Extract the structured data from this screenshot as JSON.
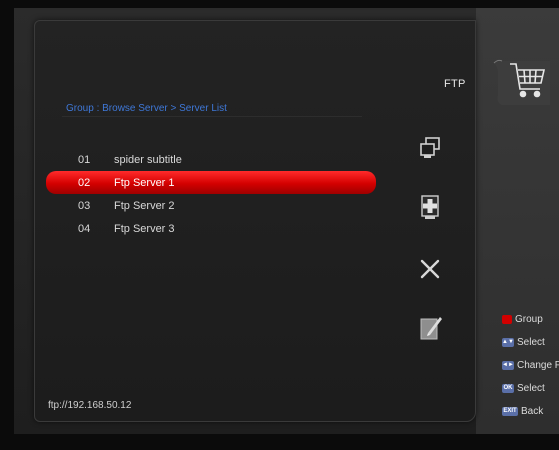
{
  "header": {
    "title": "FTP",
    "cart_icon": "shopping-cart-icon"
  },
  "breadcrumb": "Group : Browse Server > Server List",
  "servers": [
    {
      "num": "01",
      "name": "spider subtitle",
      "selected": false
    },
    {
      "num": "02",
      "name": "Ftp Server 1",
      "selected": true
    },
    {
      "num": "03",
      "name": "Ftp Server 2",
      "selected": false
    },
    {
      "num": "04",
      "name": "Ftp Server 3",
      "selected": false
    }
  ],
  "actions": [
    {
      "name": "copy-icon"
    },
    {
      "name": "add-icon"
    },
    {
      "name": "delete-icon"
    },
    {
      "name": "edit-icon"
    }
  ],
  "status": {
    "address": "ftp://192.168.50.12"
  },
  "legend": [
    {
      "key": "red",
      "label": "Group"
    },
    {
      "key": "▲▼",
      "label": "Select"
    },
    {
      "key": "◄►",
      "label": "Change Fra"
    },
    {
      "key": "OK",
      "label": "Select"
    },
    {
      "key": "EXIT",
      "label": "Back"
    }
  ],
  "colors": {
    "accent_red": "#d40000",
    "breadcrumb_blue": "#3f78d8",
    "key_blue": "#5a6fa8"
  }
}
